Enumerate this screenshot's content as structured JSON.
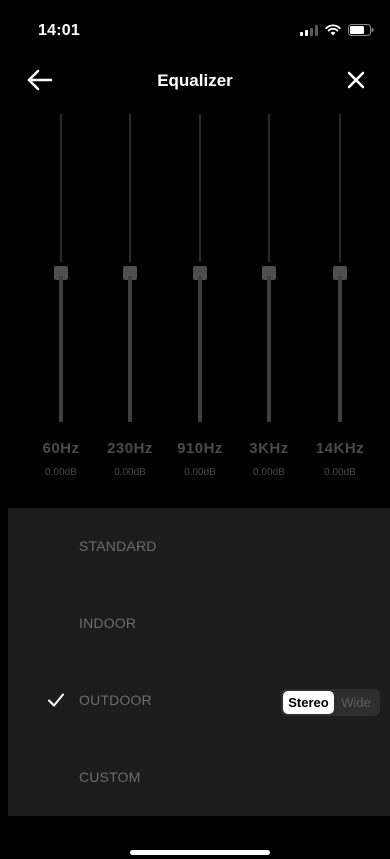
{
  "status_bar": {
    "time": "14:01"
  },
  "nav": {
    "title": "Equalizer"
  },
  "equalizer": {
    "bands": [
      {
        "frequency": "60Hz",
        "gain": "0.00dB"
      },
      {
        "frequency": "230Hz",
        "gain": "0.00dB"
      },
      {
        "frequency": "910Hz",
        "gain": "0.00dB"
      },
      {
        "frequency": "3KHz",
        "gain": "0.00dB"
      },
      {
        "frequency": "14KHz",
        "gain": "0.00dB"
      }
    ]
  },
  "presets": {
    "items": [
      {
        "label": "STANDARD",
        "selected": false
      },
      {
        "label": "INDOOR",
        "selected": false
      },
      {
        "label": "OUTDOOR",
        "selected": true
      },
      {
        "label": "CUSTOM",
        "selected": false
      }
    ],
    "mode_toggle": {
      "stereo_label": "Stereo",
      "wide_label": "Wide",
      "selected": "Stereo"
    }
  },
  "colors": {
    "background": "#000000",
    "panel": "#1c1c1c",
    "muted_text": "#4a4a4a"
  },
  "icons": {
    "back": "arrow-left-icon",
    "close": "close-icon",
    "check": "check-icon"
  }
}
